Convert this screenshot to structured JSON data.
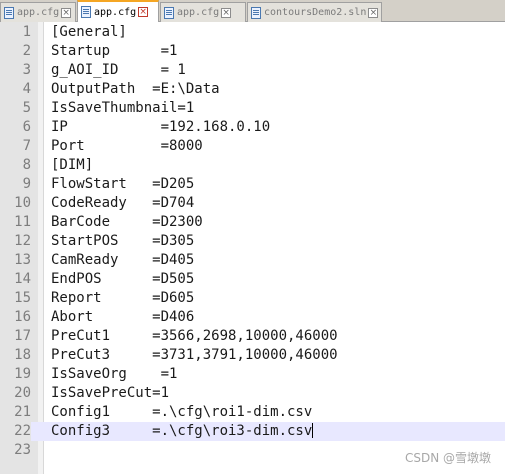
{
  "tabs": [
    {
      "label": "app.cfg",
      "active": false,
      "close_icon": "close-icon"
    },
    {
      "label": "app.cfg",
      "active": true,
      "close_icon": "close-icon"
    },
    {
      "label": "app.cfg",
      "active": false,
      "close_icon": "close-icon"
    },
    {
      "label": "contoursDemo2.sln",
      "active": false,
      "close_icon": "close-icon"
    }
  ],
  "editor": {
    "current_line": 22,
    "lines": [
      {
        "number": "1",
        "text": "[General]"
      },
      {
        "number": "2",
        "text": "Startup      =1"
      },
      {
        "number": "3",
        "text": "g_AOI_ID     = 1"
      },
      {
        "number": "4",
        "text": "OutputPath  =E:\\Data"
      },
      {
        "number": "5",
        "text": "IsSaveThumbnail=1"
      },
      {
        "number": "6",
        "text": "IP           =192.168.0.10"
      },
      {
        "number": "7",
        "text": "Port         =8000"
      },
      {
        "number": "8",
        "text": "[DIM]"
      },
      {
        "number": "9",
        "text": "FlowStart   =D205"
      },
      {
        "number": "10",
        "text": "CodeReady   =D704"
      },
      {
        "number": "11",
        "text": "BarCode     =D2300"
      },
      {
        "number": "12",
        "text": "StartPOS    =D305"
      },
      {
        "number": "13",
        "text": "CamReady    =D405"
      },
      {
        "number": "14",
        "text": "EndPOS      =D505"
      },
      {
        "number": "15",
        "text": "Report      =D605"
      },
      {
        "number": "16",
        "text": "Abort       =D406"
      },
      {
        "number": "17",
        "text": "PreCut1     =3566,2698,10000,46000"
      },
      {
        "number": "18",
        "text": "PreCut3     =3731,3791,10000,46000"
      },
      {
        "number": "19",
        "text": "IsSaveOrg    =1"
      },
      {
        "number": "20",
        "text": "IsSavePreCut=1"
      },
      {
        "number": "21",
        "text": "Config1     =.\\cfg\\roi1-dim.csv"
      },
      {
        "number": "22",
        "text": "Config3     =.\\cfg\\roi3-dim.csv"
      },
      {
        "number": "23",
        "text": ""
      }
    ]
  },
  "watermark": "CSDN @雪墩墩",
  "colors": {
    "tab_active_accent": "#f5a623",
    "current_line_bg": "#e8e8ff",
    "gutter_bg": "#e4e4e4"
  }
}
